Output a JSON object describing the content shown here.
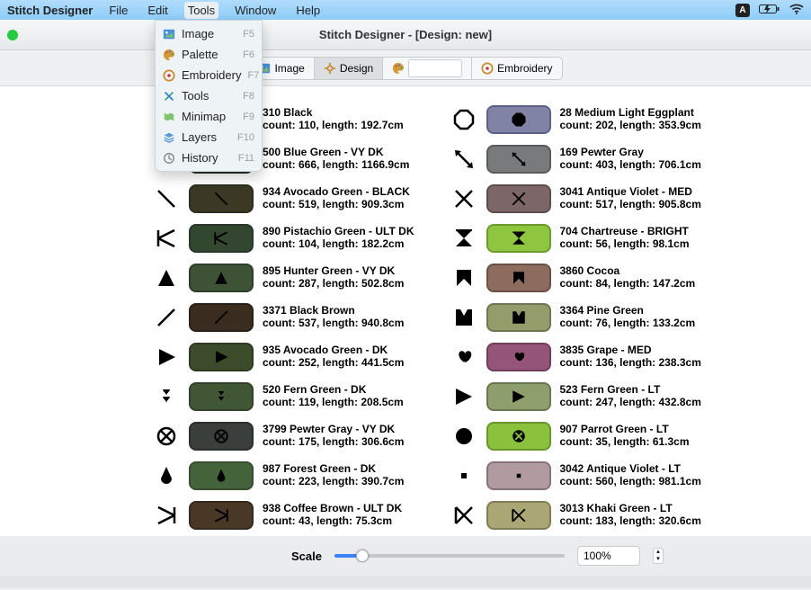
{
  "menubar": {
    "app": "Stitch Designer",
    "items": [
      "File",
      "Edit",
      "Tools",
      "Window",
      "Help"
    ]
  },
  "dropdown": [
    {
      "icon": "image",
      "label": "Image",
      "key": "F5"
    },
    {
      "icon": "palette",
      "label": "Palette",
      "key": "F6"
    },
    {
      "icon": "embroidery",
      "label": "Embroidery",
      "key": "F7"
    },
    {
      "icon": "tools",
      "label": "Tools",
      "key": "F8"
    },
    {
      "icon": "minimap",
      "label": "Minimap",
      "key": "F9"
    },
    {
      "icon": "layers",
      "label": "Layers",
      "key": "F10"
    },
    {
      "icon": "history",
      "label": "History",
      "key": "F11"
    }
  ],
  "window_title": "Stitch Designer - [Design: new]",
  "toolbar": {
    "image": "Image",
    "design": "Design",
    "embroidery": "Embroidery"
  },
  "scale": {
    "label": "Scale",
    "value": "100%"
  },
  "left": [
    {
      "sym": "square",
      "chipSym": "square",
      "color": "#101913",
      "border": "#4a4a4a",
      "name": "310 Black",
      "count": 110,
      "length": "192.7cm"
    },
    {
      "sym": "diag2dot",
      "chipSym": "diag2dot",
      "color": "#2e4538",
      "border": "#24342a",
      "name": "500 Blue Green - VY DK",
      "count": 666,
      "length": "1166.9cm"
    },
    {
      "sym": "diagnw",
      "chipSym": "diagnw",
      "color": "#3b3923",
      "border": "#2b2f21",
      "name": "934 Avocado Green - BLACK",
      "count": 519,
      "length": "909.3cm"
    },
    {
      "sym": "kleft",
      "chipSym": "kleft",
      "color": "#324630",
      "border": "#28372b",
      "name": "890 Pistachio Green - ULT DK",
      "count": 104,
      "length": "182.2cm"
    },
    {
      "sym": "triup",
      "chipSym": "triup",
      "color": "#3e5236",
      "border": "#2f3e2b",
      "name": "895 Hunter Green - VY DK",
      "count": 287,
      "length": "502.8cm"
    },
    {
      "sym": "diagne",
      "chipSym": "diagne",
      "color": "#3a2d1f",
      "border": "#2a2218",
      "name": "3371 Black Brown",
      "count": 537,
      "length": "940.8cm"
    },
    {
      "sym": "play",
      "chipSym": "play",
      "color": "#3c4b29",
      "border": "#2f3a23",
      "name": "935 Avocado Green - DK",
      "count": 252,
      "length": "441.5cm"
    },
    {
      "sym": "spade",
      "chipSym": "spade",
      "color": "#415634",
      "border": "#33432b",
      "name": "520 Fern Green - DK",
      "count": 119,
      "length": "208.5cm"
    },
    {
      "sym": "circcross",
      "chipSym": "circcross",
      "color": "#3a3f3b",
      "border": "#2b2f2c",
      "name": "3799 Pewter Gray - VY DK",
      "count": 175,
      "length": "306.6cm"
    },
    {
      "sym": "drop",
      "chipSym": "drop",
      "color": "#45633b",
      "border": "#364e30",
      "name": "987 Forest Green - DK",
      "count": 223,
      "length": "390.7cm"
    },
    {
      "sym": "kright",
      "chipSym": "kright",
      "color": "#4a3827",
      "border": "#362a1e",
      "name": "938 Coffee Brown - ULT DK",
      "count": 43,
      "length": "75.3cm"
    }
  ],
  "right": [
    {
      "sym": "octagon",
      "chipSym": "octout",
      "color": "#8082a6",
      "border": "#5d6086",
      "name": "28 Medium Light Eggplant",
      "count": 202,
      "length": "353.9cm"
    },
    {
      "sym": "arrow2",
      "chipSym": "arrow2",
      "color": "#787a7c",
      "border": "#595b5d",
      "name": "169 Pewter Gray",
      "count": 403,
      "length": "706.1cm"
    },
    {
      "sym": "x",
      "chipSym": "x",
      "color": "#7d6668",
      "border": "#5d4b4d",
      "name": "3041 Antique Violet - MED",
      "count": 517,
      "length": "905.8cm"
    },
    {
      "sym": "hourdn",
      "chipSym": "hourdn",
      "color": "#8ec63f",
      "border": "#6d9a2c",
      "name": "704 Chartreuse - BRIGHT",
      "count": 56,
      "length": "98.1cm"
    },
    {
      "sym": "banner",
      "chipSym": "banner",
      "color": "#8d6c5f",
      "border": "#6a5147",
      "name": "3860 Cocoa",
      "count": 84,
      "length": "147.2cm"
    },
    {
      "sym": "msquare",
      "chipSym": "msquare",
      "color": "#939c6a",
      "border": "#6f7650",
      "name": "3364 Pine Green",
      "count": 76,
      "length": "133.2cm"
    },
    {
      "sym": "heart",
      "chipSym": "heart",
      "color": "#945578",
      "border": "#6f3f5a",
      "name": "3835 Grape - MED",
      "count": 136,
      "length": "238.3cm"
    },
    {
      "sym": "playflag",
      "chipSym": "playflag",
      "color": "#8e9e6c",
      "border": "#6b7751",
      "name": "523 Fern Green - LT",
      "count": 247,
      "length": "432.8cm"
    },
    {
      "sym": "circx",
      "chipSym": "circx",
      "color": "#8ac23d",
      "border": "#6a962b",
      "name": "907 Parrot Green - LT",
      "count": 35,
      "length": "61.3cm"
    },
    {
      "sym": "dot",
      "chipSym": "dot",
      "color": "#b19ba1",
      "border": "#857478",
      "name": "3042 Antique Violet - LT",
      "count": 560,
      "length": "981.1cm"
    },
    {
      "sym": "kboth",
      "chipSym": "kboth",
      "color": "#aba775",
      "border": "#807d57",
      "name": "3013 Khaki Green - LT",
      "count": 183,
      "length": "320.6cm"
    }
  ]
}
